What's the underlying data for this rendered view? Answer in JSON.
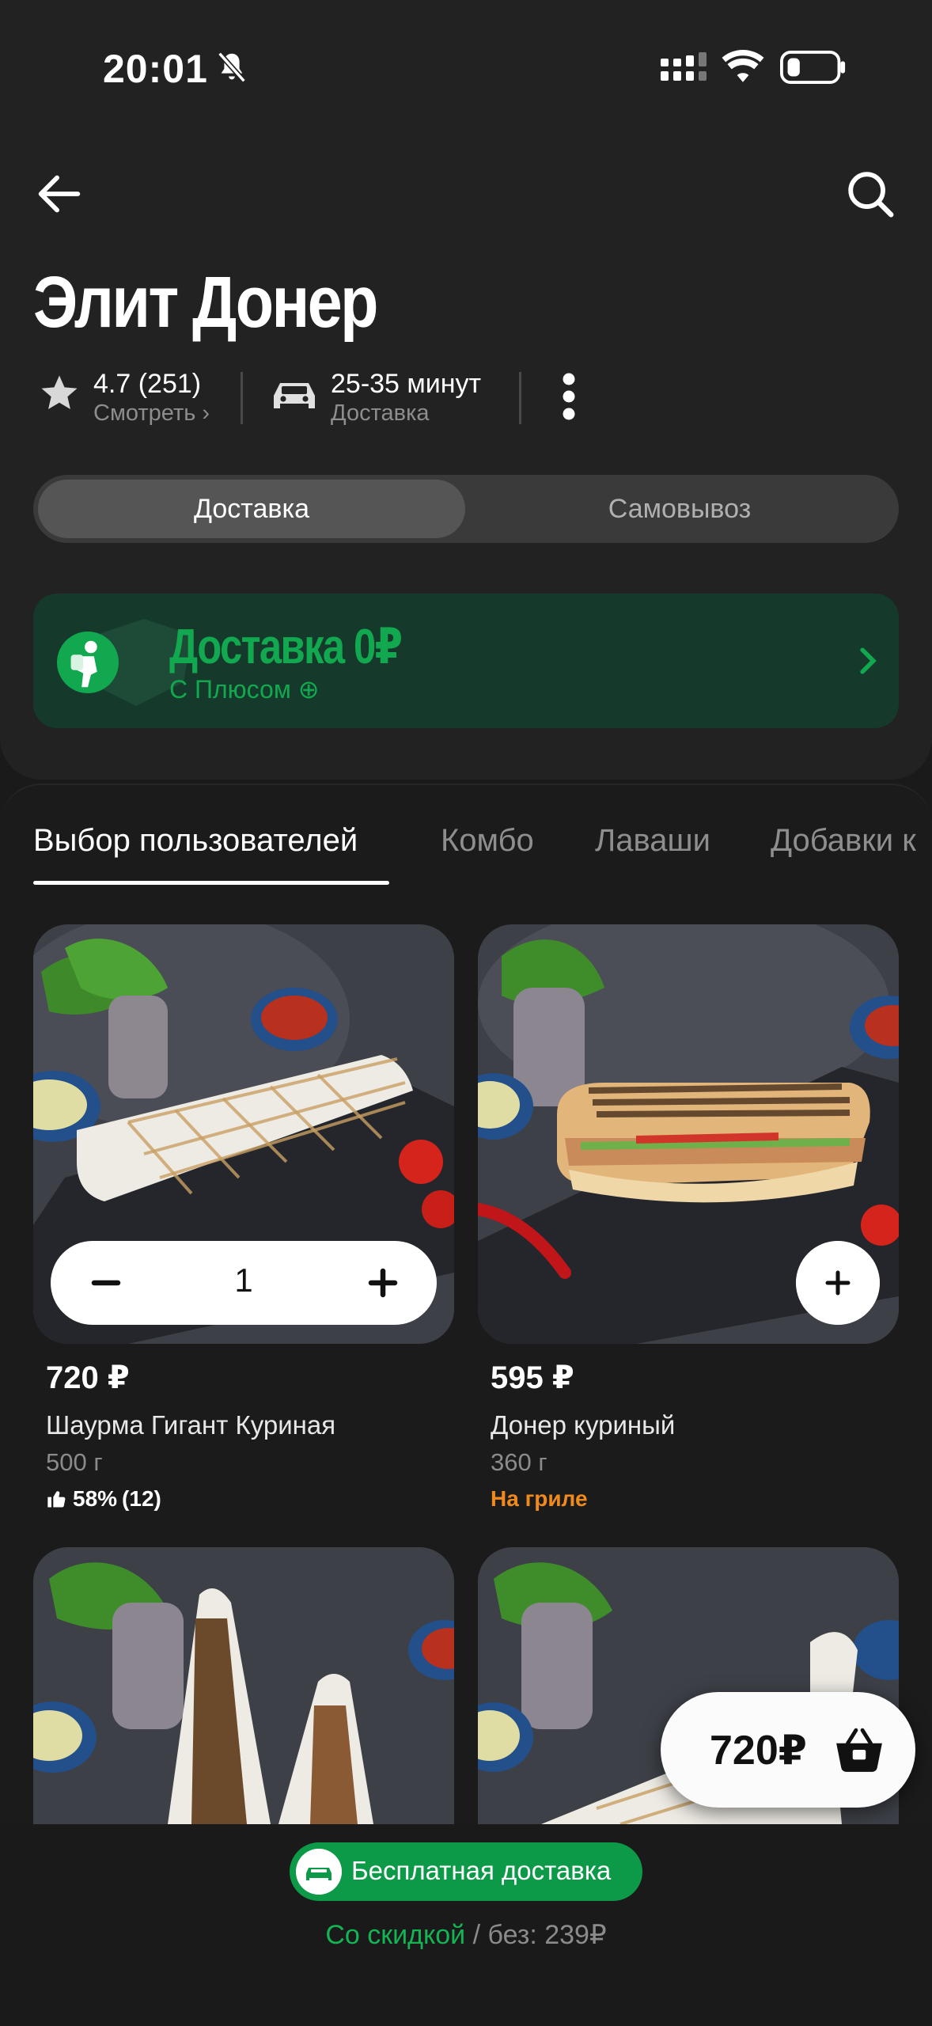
{
  "status_bar": {
    "time": "20:01"
  },
  "restaurant": {
    "title": "Элит Донер",
    "rating": "4.7 (251)",
    "rating_link": "Смотреть",
    "delivery_time": "25-35 минут",
    "delivery_label": "Доставка"
  },
  "mode_switch": {
    "active": "Доставка",
    "other": "Самовывоз"
  },
  "promo": {
    "title": "Доставка 0₽",
    "subtitle": "С Плюсом"
  },
  "tabs": [
    "Выбор пользователей",
    "Комбо",
    "Лаваши",
    "Добавки к"
  ],
  "products": [
    {
      "price": "720 ₽",
      "name": "Шаурма Гигант Куриная",
      "weight": "500 г",
      "rating": "58%",
      "rating_count": "(12)",
      "quantity": "1"
    },
    {
      "price": "595 ₽",
      "name": "Донер куриный",
      "weight": "360 г",
      "tag": "На гриле"
    }
  ],
  "cart": {
    "total": "720₽"
  },
  "bottom": {
    "free_delivery": "Бесплатная доставка",
    "discount_label": "Со скидкой",
    "without_label": "/ без: 239₽"
  }
}
